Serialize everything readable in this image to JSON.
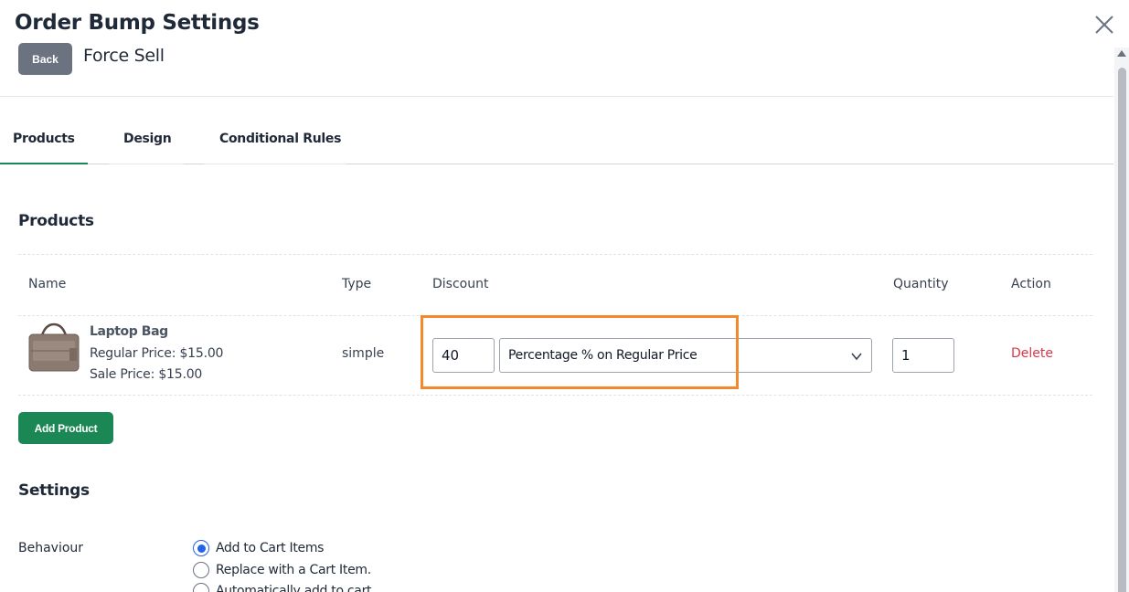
{
  "header": {
    "title": "Order Bump Settings",
    "back_label": "Back",
    "subtitle": "Force Sell",
    "close_icon": "close-icon"
  },
  "tabs": [
    {
      "label": "Products",
      "active": true
    },
    {
      "label": "Design",
      "active": false
    },
    {
      "label": "Conditional Rules",
      "active": false
    }
  ],
  "products_section": {
    "title": "Products",
    "columns": [
      "Name",
      "Type",
      "Discount",
      "Quantity",
      "Action"
    ],
    "rows": [
      {
        "name": "Laptop Bag",
        "regular_price": "Regular Price: $15.00",
        "sale_price": "Sale Price: $15.00",
        "type": "simple",
        "discount_value": "40",
        "discount_type": "Percentage % on Regular Price",
        "quantity": "1",
        "action": "Delete"
      }
    ],
    "add_button": "Add Product"
  },
  "settings_section": {
    "title": "Settings",
    "behaviour_label": "Behaviour",
    "options": [
      {
        "label": "Add to Cart Items",
        "checked": true
      },
      {
        "label": "Replace with a Cart Item.",
        "checked": false
      },
      {
        "label": "Automatically add to cart",
        "checked": false
      }
    ]
  },
  "colors": {
    "primary_green": "#1a8754",
    "delete_red": "#dc3545",
    "highlight_orange": "#f08a2c",
    "radio_blue": "#2563eb"
  }
}
